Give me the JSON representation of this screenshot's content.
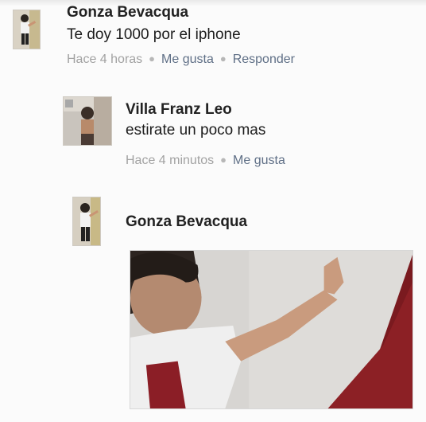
{
  "comments": [
    {
      "author": "Gonza Bevacqua",
      "text": "Te doy 1000 por el  iphone",
      "time": "Hace 4 horas",
      "like_label": "Me gusta",
      "reply_label": "Responder"
    },
    {
      "author": "Villa Franz Leo",
      "text": "estirate un poco mas",
      "time": "Hace 4 minutos",
      "like_label": "Me gusta"
    },
    {
      "author": "Gonza Bevacqua"
    }
  ],
  "colors": {
    "action": "#5f6f86",
    "timestamp": "#a2a2a2",
    "author": "#222222"
  }
}
